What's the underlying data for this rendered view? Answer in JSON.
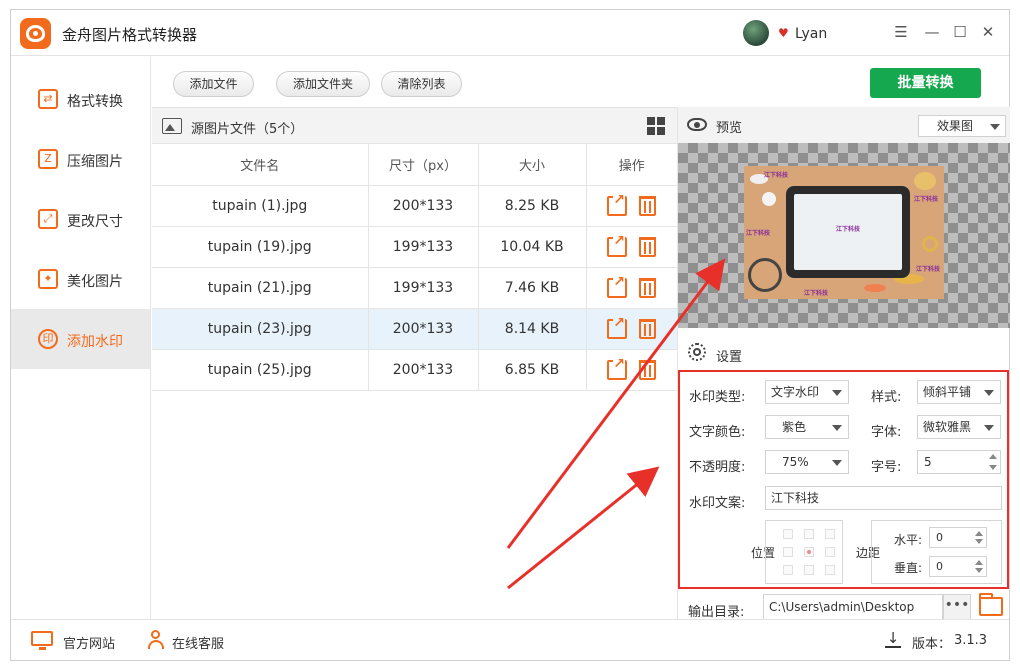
{
  "app": {
    "title": "金舟图片格式转换器",
    "username": "Lyan"
  },
  "window_controls": {
    "menu": "☰",
    "minimize": "—",
    "maximize": "☐",
    "close": "✕"
  },
  "sidebar": {
    "items": [
      {
        "label": "格式转换",
        "icon": "format-convert-icon"
      },
      {
        "label": "压缩图片",
        "icon": "compress-icon"
      },
      {
        "label": "更改尺寸",
        "icon": "resize-icon"
      },
      {
        "label": "美化图片",
        "icon": "beautify-icon"
      },
      {
        "label": "添加水印",
        "icon": "watermark-icon",
        "active": true
      }
    ]
  },
  "toolbar": {
    "add_file": "添加文件",
    "add_folder": "添加文件夹",
    "clear_list": "清除列表",
    "batch_convert": "批量转换"
  },
  "files": {
    "title": "源图片文件（5个）",
    "columns": [
      "文件名",
      "尺寸（px）",
      "大小",
      "操作"
    ],
    "rows": [
      {
        "name": "tupain (1).jpg",
        "size_px": "200*133",
        "size": "8.25 KB"
      },
      {
        "name": "tupain (19).jpg",
        "size_px": "199*133",
        "size": "10.04 KB"
      },
      {
        "name": "tupain (21).jpg",
        "size_px": "199*133",
        "size": "7.46 KB"
      },
      {
        "name": "tupain (23).jpg",
        "size_px": "200*133",
        "size": "8.14 KB",
        "selected": true
      },
      {
        "name": "tupain (25).jpg",
        "size_px": "200*133",
        "size": "6.85 KB"
      }
    ]
  },
  "preview": {
    "label": "预览",
    "mode": "效果图",
    "watermark_text": "江下科技"
  },
  "settings": {
    "label": "设置",
    "watermark_type_label": "水印类型:",
    "watermark_type": "文字水印",
    "style_label": "样式:",
    "style": "倾斜平铺",
    "text_color_label": "文字颜色:",
    "text_color": "紫色",
    "font_label": "字体:",
    "font": "微软雅黑",
    "opacity_label": "不透明度:",
    "opacity": "75%",
    "font_size_label": "字号:",
    "font_size": "5",
    "text_label": "水印文案:",
    "text": "江下科技",
    "position_label": "位置",
    "margin_label": "边距",
    "horizontal_label": "水平:",
    "horizontal": "0",
    "vertical_label": "垂直:",
    "vertical": "0"
  },
  "output": {
    "label": "输出目录:",
    "path": "C:\\Users\\admin\\Desktop",
    "browse": "•••"
  },
  "statusbar": {
    "website": "官方网站",
    "support": "在线客服",
    "version_label": "版本：",
    "version": "3.1.3"
  },
  "colors": {
    "accent": "#f26b1d",
    "primary_button": "#16a84e",
    "highlight_box": "#e8302a",
    "selected_row": "#e7f2fb",
    "watermark": "#8a2d9c"
  }
}
